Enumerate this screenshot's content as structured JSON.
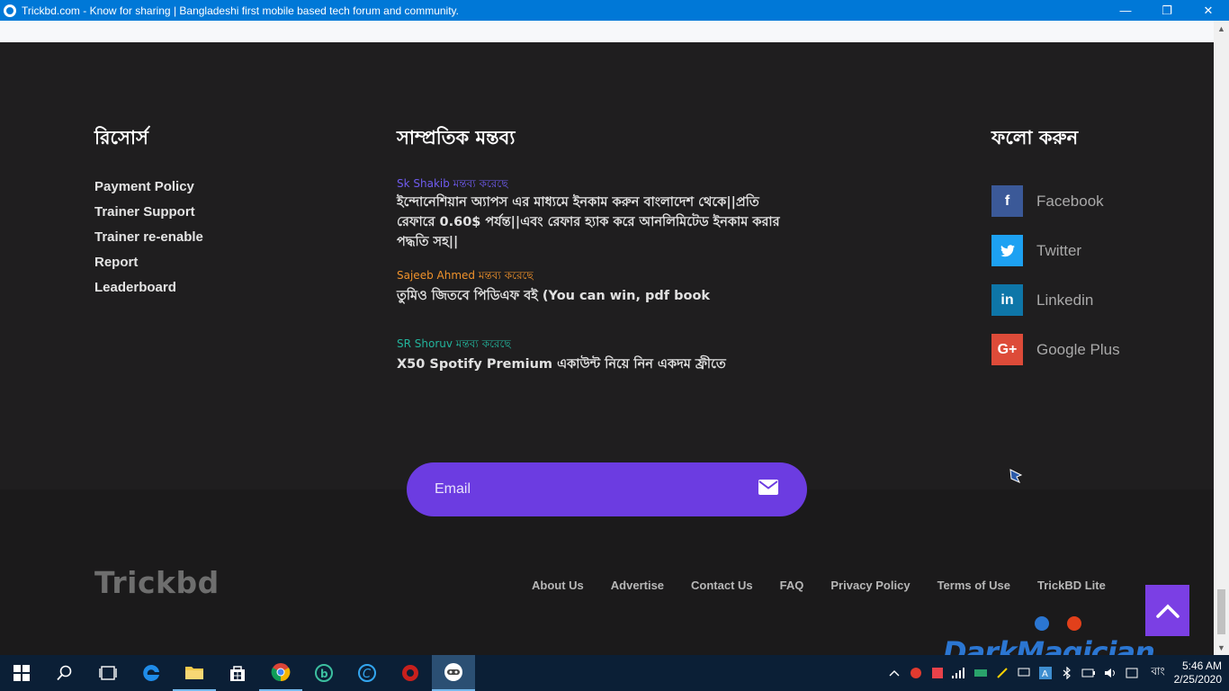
{
  "window": {
    "title": "Trickbd.com - Know for sharing | Bangladeshi first mobile based tech forum and community.",
    "minimize": "—",
    "restore": "❐",
    "close": "✕"
  },
  "resources": {
    "heading": "রিসোর্স",
    "items": [
      "Payment Policy",
      "Trainer Support",
      "Trainer re-enable",
      "Report",
      "Leaderboard"
    ]
  },
  "comments": {
    "heading": "সাম্প্রতিক মন্তব্য",
    "items": [
      {
        "author": "Sk Shakib মন্তব্য করেছে",
        "author_color": "#6f5bef",
        "text": "ইন্দোনেশিয়ান অ্যাপস এর মাধ্যমে ইনকাম করুন বাংলাদেশ থেকে||প্রতি রেফারে 0.60$ পর্যন্ত||এবং রেফার হ্যাক করে আনলিমিটেড ইনকাম করার পদ্ধতি সহ||"
      },
      {
        "author": "Sajeeb Ahmed মন্তব্য করেছে",
        "author_color": "#f0922b",
        "text": "তুমিও জিতবে পিডিএফ বই (You can win, pdf book"
      },
      {
        "author": "SR Shoruv মন্তব্য করেছে",
        "author_color": "#23b49c",
        "text": "X50 Spotify Premium একাউন্ট নিয়ে নিন একদম ফ্রীতে"
      }
    ]
  },
  "follow": {
    "heading": "ফলো করুন",
    "items": [
      {
        "label": "Facebook",
        "icon": "facebook-icon",
        "glyph": "f",
        "color": "#3b5998"
      },
      {
        "label": "Twitter",
        "icon": "twitter-icon",
        "glyph": "t",
        "color": "#1da1f2"
      },
      {
        "label": "Linkedin",
        "icon": "linkedin-icon",
        "glyph": "in",
        "color": "#0e76a8"
      },
      {
        "label": "Google Plus",
        "icon": "google-plus-icon",
        "glyph": "G+",
        "color": "#dd4b39"
      }
    ]
  },
  "newsletter": {
    "placeholder": "Email"
  },
  "footer": {
    "logo": "Trickbd",
    "links": [
      "About Us",
      "Advertise",
      "Contact Us",
      "FAQ",
      "Privacy Policy",
      "Terms of Use",
      "TrickBD Lite"
    ]
  },
  "watermark": {
    "text": "DarkMagician"
  },
  "taskbar": {
    "apps": [
      "windows-start",
      "search",
      "task-view",
      "edge",
      "file-explorer",
      "store",
      "chrome",
      "app-b",
      "app-c",
      "app-shield",
      "trickbd-browser"
    ],
    "language": "বাং",
    "time": "5:46 AM",
    "date": "2/25/2020"
  },
  "colors": {
    "accent": "#6c3ce1",
    "titlebar": "#0078d7",
    "footer_bg": "#1f1e1f"
  }
}
